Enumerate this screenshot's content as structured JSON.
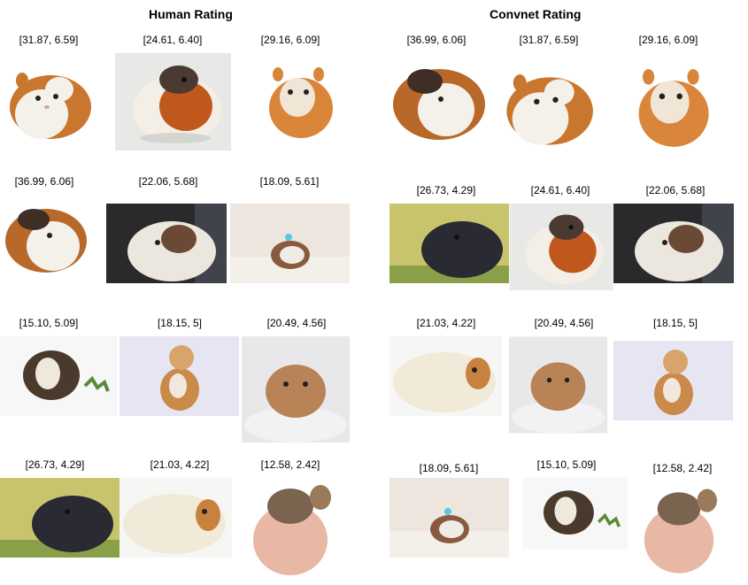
{
  "titles": {
    "human": "Human Rating",
    "convnet": "Convnet Rating"
  },
  "human": {
    "captions": [
      "[31.87, 6.59]",
      "[24.61, 6.40]",
      "[29.16, 6.09]",
      "[36.99, 6.06]",
      "[22.06, 5.68]",
      "[18.09, 5.61]",
      "[15.10, 5.09]",
      "[18.15, 5]",
      "[20.49, 4.56]",
      "[26.73, 4.29]",
      "[21.03, 4.22]",
      "[12.58, 2.42]"
    ]
  },
  "convnet": {
    "captions": [
      "[36.99, 6.06]",
      "[31.87, 6.59]",
      "[29.16, 6.09]",
      "[26.73, 4.29]",
      "[24.61, 6.40]",
      "[22.06, 5.68]",
      "[21.03, 4.22]",
      "[20.49, 4.56]",
      "[18.15, 5]",
      "[18.09, 5.61]",
      "[15.10, 5.09]",
      "[12.58, 2.42]"
    ]
  }
}
